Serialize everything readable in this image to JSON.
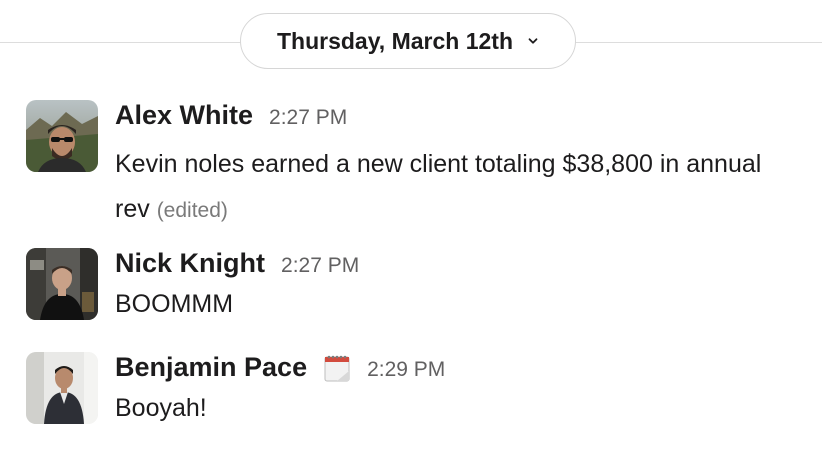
{
  "date_divider": {
    "label": "Thursday, March 12th",
    "icon": "chevron-down-icon"
  },
  "messages": [
    {
      "author": "Alex White",
      "time": "2:27 PM",
      "text": "Kevin noles earned a new client totaling $38,800 in annual rev",
      "edited_label": "(edited)",
      "avatar": "avatar-photo"
    },
    {
      "author": "Nick Knight",
      "time": "2:27 PM",
      "text": "BOOMMM",
      "avatar": "avatar-photo"
    },
    {
      "author": "Benjamin Pace",
      "status_icon": "spiral-calendar-icon",
      "time": "2:29 PM",
      "text": "Booyah!",
      "avatar": "avatar-photo"
    }
  ]
}
